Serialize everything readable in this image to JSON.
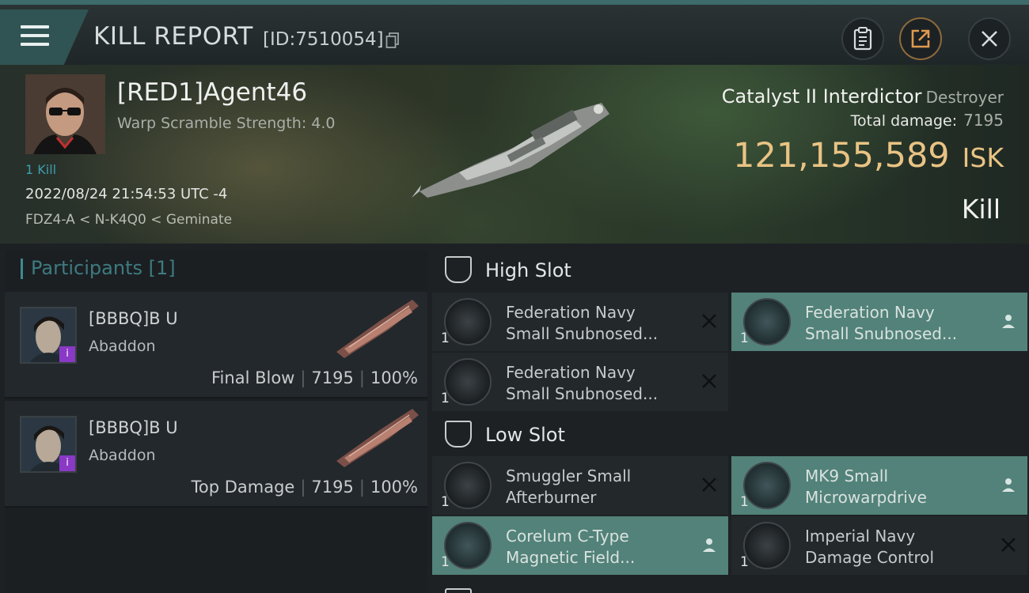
{
  "header": {
    "title": "KILL REPORT",
    "report_id": "[ID:7510054]"
  },
  "victim": {
    "pilot": "[RED1]Agent46",
    "warp_scramble": "Warp Scramble Strength: 4.0",
    "kills": "1 Kill",
    "datetime": "2022/08/24 21:54:53 UTC -4",
    "location": "FDZ4-A < N-K4Q0 < Geminate",
    "ship_name": "Catalyst II Interdictor",
    "ship_class": "Destroyer",
    "total_damage_label": "Total damage:",
    "total_damage": "7195",
    "isk_value": "121,155,589",
    "isk_unit": "ISK",
    "result": "Kill"
  },
  "participants": {
    "title": "Participants",
    "count": "[1]",
    "rows": [
      {
        "name": "[BBBQ]B U",
        "ship": "Abaddon",
        "role": "Final Blow",
        "damage": "7195",
        "percent": "100%"
      },
      {
        "name": "[BBBQ]B U",
        "ship": "Abaddon",
        "role": "Top Damage",
        "damage": "7195",
        "percent": "100%"
      }
    ]
  },
  "fitting": {
    "high_slot_label": "High Slot",
    "low_slot_label": "Low Slot",
    "high_slot": [
      {
        "qty": "1",
        "line1": "Federation Navy",
        "line2": "Small Snubnosed...",
        "status": "destroyed"
      },
      {
        "qty": "1",
        "line1": "Federation Navy",
        "line2": "Small Snubnosed...",
        "status": "dropped"
      },
      {
        "qty": "1",
        "line1": "Federation Navy",
        "line2": "Small Snubnosed...",
        "status": "destroyed"
      }
    ],
    "low_slot": [
      {
        "qty": "1",
        "line1": "Smuggler Small",
        "line2": "Afterburner",
        "status": "destroyed"
      },
      {
        "qty": "1",
        "line1": "MK9 Small",
        "line2": "Microwarpdrive",
        "status": "dropped"
      },
      {
        "qty": "1",
        "line1": "Corelum C-Type",
        "line2": "Magnetic Field...",
        "status": "dropped"
      },
      {
        "qty": "1",
        "line1": "Imperial Navy",
        "line2": "Damage Control",
        "status": "destroyed"
      }
    ]
  },
  "colors": {
    "accent_teal": "#3e8a90",
    "isk_gold": "#e9c384",
    "dropped_bg": "#528279",
    "corp_badge": "#8a38c6"
  },
  "icons": [
    "menu-icon",
    "copy-icon",
    "clipboard-icon",
    "share-icon",
    "close-icon",
    "high-slot-icon",
    "low-slot-icon",
    "destroyed-x-icon",
    "dropped-person-icon"
  ]
}
